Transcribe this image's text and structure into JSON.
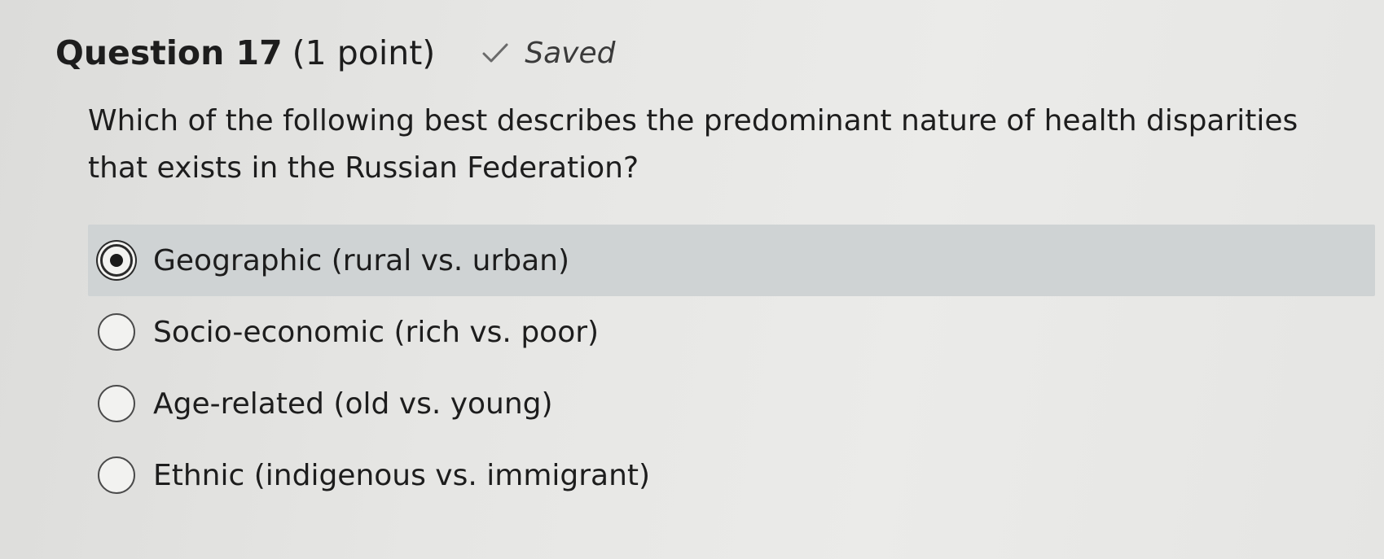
{
  "question": {
    "title": "Question 17",
    "points": "(1 point)",
    "status": "Saved",
    "status_icon": "check-icon",
    "prompt": "Which of the following best describes the predominant nature of health disparities that exists in the Russian Federation?"
  },
  "options": [
    {
      "label": "Geographic (rural vs. urban)",
      "selected": true
    },
    {
      "label": "Socio-economic (rich vs. poor)",
      "selected": false
    },
    {
      "label": "Age-related (old vs. young)",
      "selected": false
    },
    {
      "label": "Ethnic (indigenous vs. immigrant)",
      "selected": false
    }
  ],
  "colors": {
    "selected_row": "#cfd3d4",
    "text": "#1d1d1d"
  }
}
